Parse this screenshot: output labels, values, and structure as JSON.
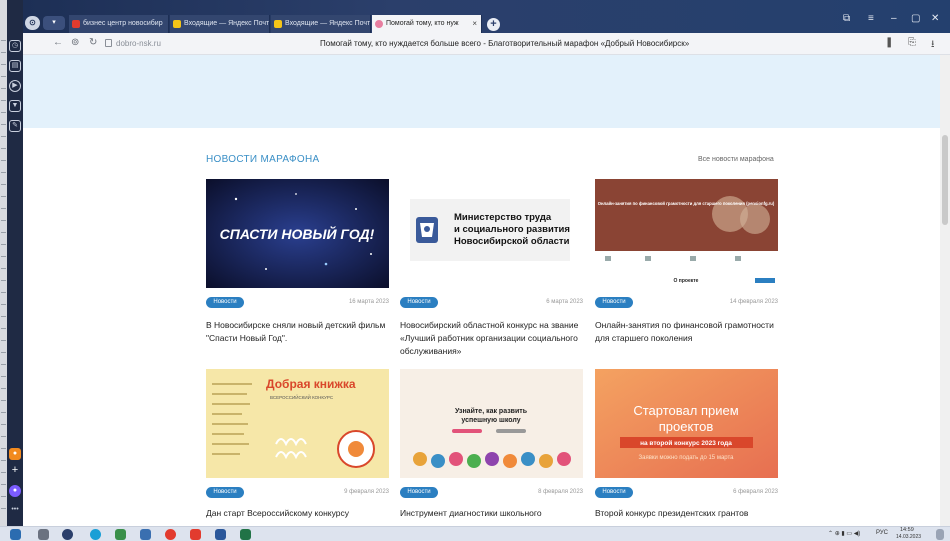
{
  "browser": {
    "app_label": "⊙",
    "menu_label": "▾",
    "tabs": [
      {
        "label": "бизнес центр новосибир",
        "color": "#e23b2e"
      },
      {
        "label": "Входящие — Яндекс Почт",
        "color": "#f5c518"
      },
      {
        "label": "Входящие — Яндекс Почт",
        "color": "#f5c518"
      },
      {
        "label": "Помогай тому, кто нуж",
        "color": "#e77ea0"
      }
    ],
    "new_tab": "+",
    "close_tab": "×",
    "url": "dobro-nsk.ru",
    "page_title": "Помогай тому, кто нуждается больше всего - Благотворительный марафон «Добрый Новосибирск»",
    "window_controls": [
      "⧉",
      "≡",
      "–",
      "▢",
      "✕"
    ]
  },
  "section": {
    "title": "НОВОСТИ МАРАФОНА",
    "all_link": "Все новости марафона"
  },
  "cards": [
    {
      "badge": "Новости",
      "date": "16 марта 2023",
      "title": "В Новосибирске сняли новый детский фильм \"Спасти Новый Год\".",
      "img_text": "СПАСТИ НОВЫЙ ГОД!"
    },
    {
      "badge": "Новости",
      "date": "6 марта 2023",
      "title": "Новосибирский областной конкурс на звание «Лучший работник организации социального обслуживания»",
      "img_text_1": "Министерство труда",
      "img_text_2": "и социального развития",
      "img_text_3": "Новосибирской области"
    },
    {
      "badge": "Новости",
      "date": "14 февраля 2023",
      "title": "Онлайн-занятия по финансовой грамотности для старшего поколения",
      "img_text": "О проекте",
      "img_head": "Онлайн-занятия по финансовой грамотности для старшего поколения (pensionfg.ru)"
    },
    {
      "badge": "Новости",
      "date": "9 февраля 2023",
      "title": "Дан старт Всероссийскому конкурсу",
      "img_text": "Добрая книжка",
      "img_sub": "ВСЕРОССИЙСКИЙ КОНКУРС"
    },
    {
      "badge": "Новости",
      "date": "8 февраля 2023",
      "title": "Инструмент диагностики школьного",
      "img_text_1": "Узнайте, как развить",
      "img_text_2": "успешную школу"
    },
    {
      "badge": "Новости",
      "date": "6 февраля 2023",
      "title": "Второй конкурс президентских грантов",
      "img_text_1": "Стартовал прием",
      "img_text_2": "проектов",
      "img_text_3": "на второй конкурс 2023 года",
      "img_text_4": "Заявки можно подать до 15 марта"
    }
  ],
  "taskbar": {
    "lang": "РУС",
    "time": "14:59",
    "date": "14.03.2023"
  },
  "colors": {
    "accent": "#2b7fc1",
    "title_blue": "#3a8fc6",
    "hero": "#e3f1fb"
  }
}
